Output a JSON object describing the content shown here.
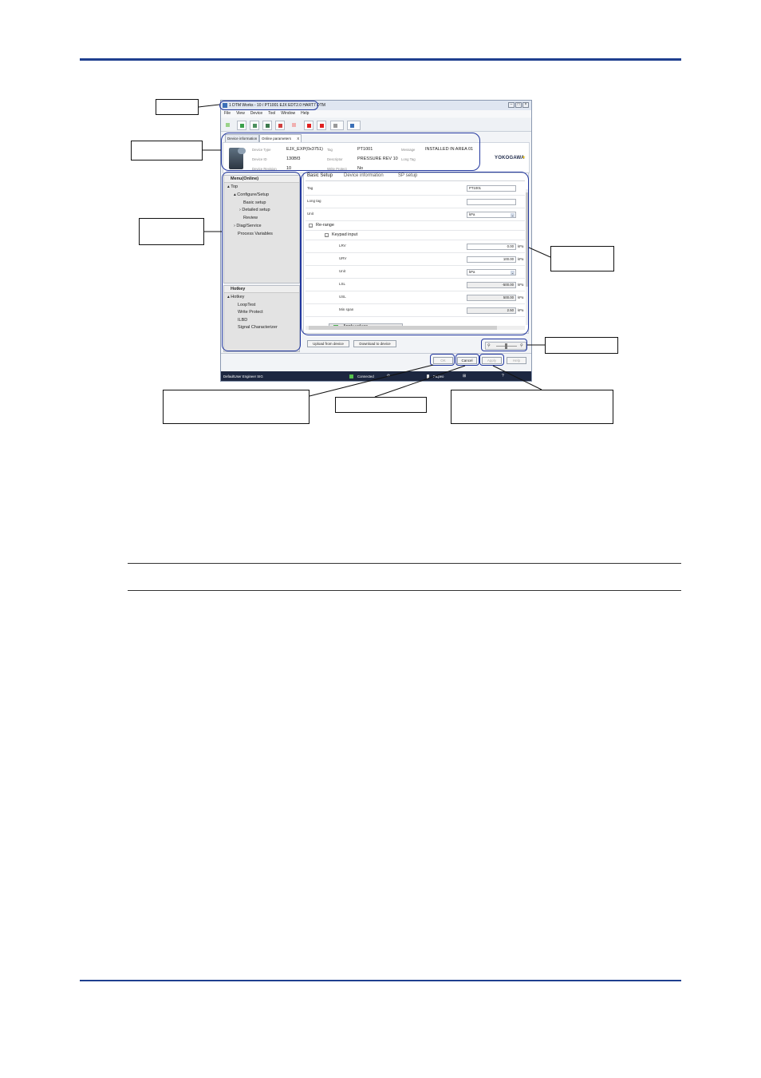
{
  "window": {
    "title": "1 DTM Works - 10 / PT1001 EJX EDT2.0 HART7 DTM",
    "menu": [
      "File",
      "View",
      "Device",
      "Tool",
      "Window",
      "Help"
    ],
    "tabs": [
      "Device information",
      "Online parameters",
      "X"
    ]
  },
  "device_header": {
    "labels": {
      "device_type": "Device Type",
      "device_id": "Device ID",
      "device_revision": "Device Revision",
      "tag": "Tag",
      "descriptor": "Descriptor",
      "write_protect": "Write Protect",
      "message": "Message",
      "long_tag": "Long Tag"
    },
    "values": {
      "device_type": "EJX_EXP(0x3751)",
      "device_id": "130Bf3",
      "device_revision": "10",
      "tag": "PT1001",
      "descriptor": "PRESSURE REV 10",
      "write_protect": "No",
      "message": "INSTALLED IN AREA 01"
    },
    "logo": "YOKOGAWA"
  },
  "menu_tree": {
    "header": "Menu(Online)",
    "items": [
      "Top",
      "Configure/Setup",
      "Basic setup",
      "Detailed setup",
      "Review",
      "Diag/Service",
      "Process Variables"
    ]
  },
  "hotkey": {
    "header": "Hotkey",
    "items": [
      "Hotkey",
      "LoopTest",
      "Write Protect",
      "ILBD",
      "Signal Characterizer"
    ]
  },
  "params": {
    "tabs": [
      "Basic Setup",
      "Device information",
      "SP setup"
    ],
    "tag_label": "Tag",
    "tag_value": "PT1001",
    "long_tag_label": "Long tag",
    "unit_label": "Unit",
    "unit_value": "kPa",
    "rerange_label": "Re-range",
    "keypad_label": "Keypad input",
    "lrv_label": "LRV",
    "lrv_value": "0.00",
    "lrv_unit": "kPa",
    "urv_label": "URV",
    "urv_value": "100.00",
    "urv_unit": "kPa",
    "unit2_label": "Unit",
    "unit2_value": "kPa",
    "lsl_label": "LSL",
    "lsl_value": "-500.00",
    "lsl_unit": "kPa",
    "usl_label": "USL",
    "usl_value": "500.00",
    "usl_unit": "kPa",
    "minspan_label": "Min span",
    "minspan_value": "2.50",
    "minspan_unit": "kPa",
    "apply_values": "Apply values"
  },
  "buttons": {
    "upload": "Upload from device",
    "download": "Download to device",
    "ok": "OK",
    "cancel": "Cancel",
    "apply": "Apply",
    "help": "Help"
  },
  "statusbar": {
    "user": "DefaultUser  Engineer  SIG",
    "connected": "Connected",
    "project": "FtLpeo"
  },
  "colors": {
    "callout_ring": "#22379e",
    "page_rule": "#1f3f8f",
    "status_bar": "#1d2740"
  }
}
